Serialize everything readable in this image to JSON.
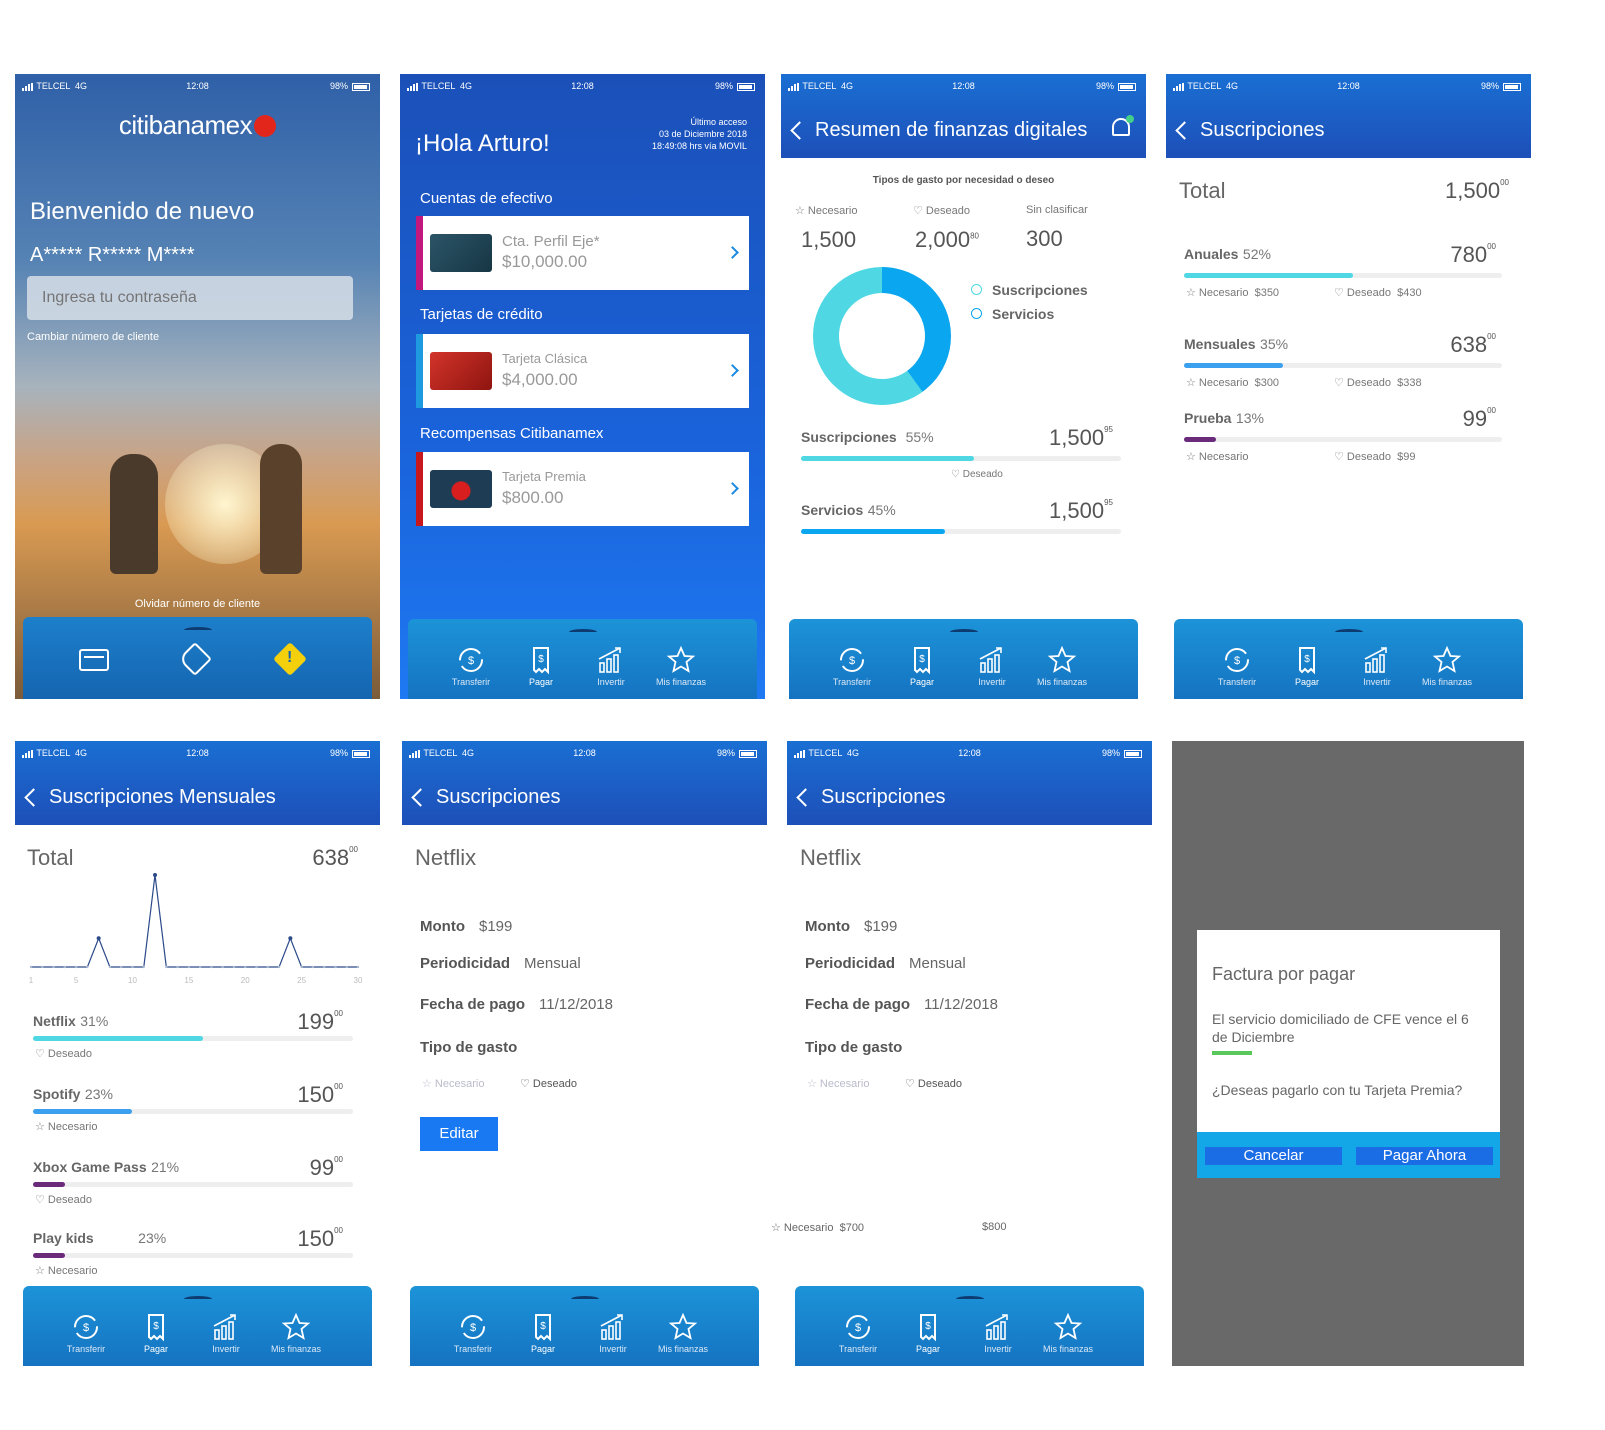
{
  "status": {
    "carrier": "TELCEL",
    "network": "4G",
    "time": "12:08",
    "battery": "98%"
  },
  "tabs": [
    {
      "label": "Transferir",
      "icon": "transfer-icon"
    },
    {
      "label": "Pagar",
      "icon": "receipt-icon"
    },
    {
      "label": "Invertir",
      "icon": "chart-up-icon"
    },
    {
      "label": "Mis finanzas",
      "icon": "star-icon"
    }
  ],
  "login": {
    "brand": "citibanamex",
    "welcome": "Bienvenido de nuevo",
    "masked_name": "A***** R***** M****",
    "password_placeholder": "Ingresa tu contraseña",
    "change_client": "Cambiar número de cliente",
    "forgot_client": "Olvidar número de cliente"
  },
  "home": {
    "greeting": "¡Hola Arturo!",
    "last_access_title": "Último acceso",
    "last_access_date": "03 de Diciembre 2018",
    "last_access_time": "18:49:08 hrs vía MOVIL",
    "sections": [
      {
        "title": "Cuentas de efectivo",
        "name": "Cta. Perfil Eje*",
        "amount": "$10,000.00",
        "stripe": "#c2187e",
        "thumb": "#2b5568"
      },
      {
        "title": "Tarjetas de crédito",
        "name": "Tarjeta Clásica",
        "amount": "$4,000.00",
        "stripe": "#1e9be0",
        "thumb": "#b8221c"
      },
      {
        "title": "Recompensas Citibanamex",
        "name": "Tarjeta Premia",
        "amount": "$800.00",
        "stripe": "#c7161c",
        "thumb": "#1f3c55"
      }
    ]
  },
  "summary": {
    "title": "Resumen de finanzas digitales",
    "chart_heading": "Tipos de gasto por necesidad o deseo",
    "categories": [
      {
        "label": "Necesario",
        "value": "1,500",
        "cents": ""
      },
      {
        "label": "Deseado",
        "value": "2,000",
        "cents": "80"
      },
      {
        "label": "Sin clasificar",
        "value": "300",
        "cents": ""
      }
    ],
    "legend": [
      "Suscripciones",
      "Servicios"
    ],
    "rows": [
      {
        "label": "Suscripciones",
        "pct": "55%",
        "amount": "1,500",
        "cents": "95",
        "tag": "Deseado"
      },
      {
        "label": "Servicios",
        "pct": "45%",
        "amount": "1,500",
        "cents": "95"
      }
    ]
  },
  "subs": {
    "title": "Suscripciones",
    "total_label": "Total",
    "total_value": "1,500",
    "total_cents": "00",
    "groups": [
      {
        "label": "Anuales",
        "pct": "52%",
        "amount": "780",
        "cents": "00",
        "need": "Necesario",
        "need_val": "$350",
        "want": "Deseado",
        "want_val": "$430"
      },
      {
        "label": "Mensuales",
        "pct": "35%",
        "amount": "638",
        "cents": "00",
        "need": "Necesario",
        "need_val": "$300",
        "want": "Deseado",
        "want_val": "$338"
      },
      {
        "label": "Prueba",
        "pct": "13%",
        "amount": "99",
        "cents": "00",
        "need": "Necesario",
        "need_val": "",
        "want": "Deseado",
        "want_val": "$99"
      }
    ]
  },
  "monthly": {
    "title": "Suscripciones Mensuales",
    "total_label": "Total",
    "total_value": "638",
    "total_cents": "00",
    "items": [
      {
        "label": "Netflix",
        "pct": "31%",
        "amount": "199",
        "cents": "00",
        "tag": "Deseado",
        "tag_icon": "heart"
      },
      {
        "label": "Spotify",
        "pct": "23%",
        "amount": "150",
        "cents": "00",
        "tag": "Necesario",
        "tag_icon": "star"
      },
      {
        "label": "Xbox Game Pass",
        "pct": "21%",
        "amount": "99",
        "cents": "00",
        "tag": "Deseado",
        "tag_icon": "heart"
      },
      {
        "label": "Play kids",
        "pct": "23%",
        "amount": "150",
        "cents": "00",
        "tag": "Necesario",
        "tag_icon": "star"
      }
    ]
  },
  "chart_data": {
    "type": "line",
    "x_ticks": [
      "1",
      "5",
      "10",
      "15",
      "20",
      "25",
      "30"
    ],
    "xlim": [
      1,
      30
    ],
    "x": [
      1,
      2,
      3,
      4,
      5,
      6,
      7,
      8,
      9,
      10,
      11,
      12,
      13,
      14,
      15,
      16,
      17,
      18,
      19,
      20,
      21,
      22,
      23,
      24,
      25,
      26,
      27,
      28,
      29,
      30
    ],
    "values": [
      0,
      0,
      0,
      0,
      0,
      0,
      199,
      0,
      0,
      0,
      0,
      638,
      0,
      0,
      0,
      0,
      0,
      0,
      0,
      0,
      0,
      0,
      0,
      199,
      0,
      0,
      0,
      0,
      0,
      0
    ]
  },
  "detail": {
    "title": "Suscripciones",
    "service": "Netflix",
    "monto_label": "Monto",
    "monto": "$199",
    "period_label": "Periodicidad",
    "period": "Mensual",
    "date_label": "Fecha de pago",
    "date": "11/12/2018",
    "type_label": "Tipo de gasto",
    "need": "Necesario",
    "want": "Deseado",
    "edit": "Editar",
    "stray_need": "Necesario",
    "stray_need_val": "$700",
    "stray_want_val": "$800"
  },
  "dialog": {
    "title": "Factura por pagar",
    "message": "El servicio domiciliado de CFE vence el 6 de Diciembre",
    "question": "¿Deseas pagarlo con tu Tarjeta Premia?",
    "cancel": "Cancelar",
    "pay": "Pagar Ahora"
  },
  "colors": {
    "primary": "#1b5fc7",
    "cyan": "#4dd9e0",
    "blue": "#0aa0f0",
    "purple": "#6a2c7a",
    "dialog_bg": "#696969",
    "accent_green": "#5ac85a"
  }
}
